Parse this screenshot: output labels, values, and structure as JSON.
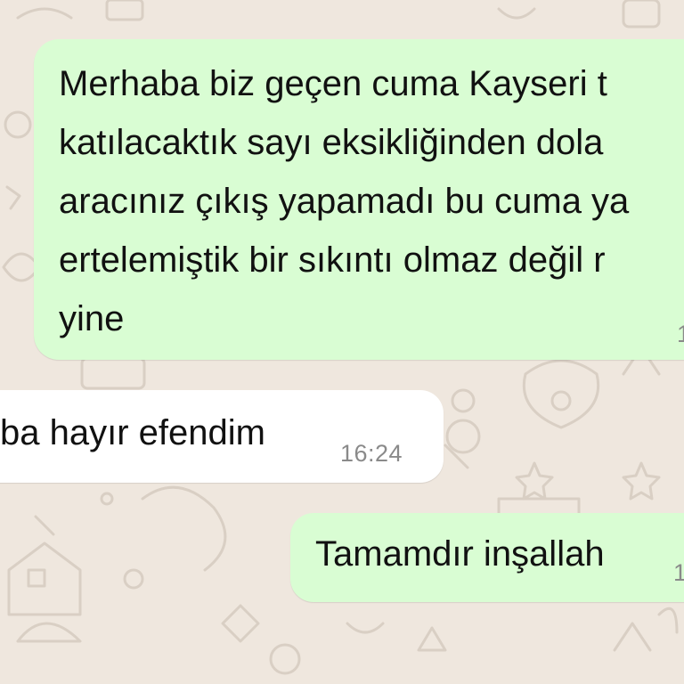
{
  "colors": {
    "wallpaper": "#efe7de",
    "doodle": "#d9cfc4",
    "outgoing_bubble": "#d9fdd3",
    "incoming_bubble": "#ffffff",
    "message_text": "#111111",
    "timestamp_text": "#8a8a8a"
  },
  "messages": [
    {
      "direction": "outgoing",
      "lines": [
        "Merhaba biz geçen cuma Kayseri t",
        "katılacaktık sayı eksikliğinden dola",
        "aracınız çıkış yapamadı bu cuma ya",
        "ertelemiştik bir sıkıntı olmaz değil r",
        "yine"
      ],
      "partial_time": "1"
    },
    {
      "direction": "incoming",
      "text": "ba hayır efendim",
      "time": "16:24"
    },
    {
      "direction": "outgoing",
      "text": "Tamamdır inşallah",
      "partial_time": "1"
    }
  ]
}
